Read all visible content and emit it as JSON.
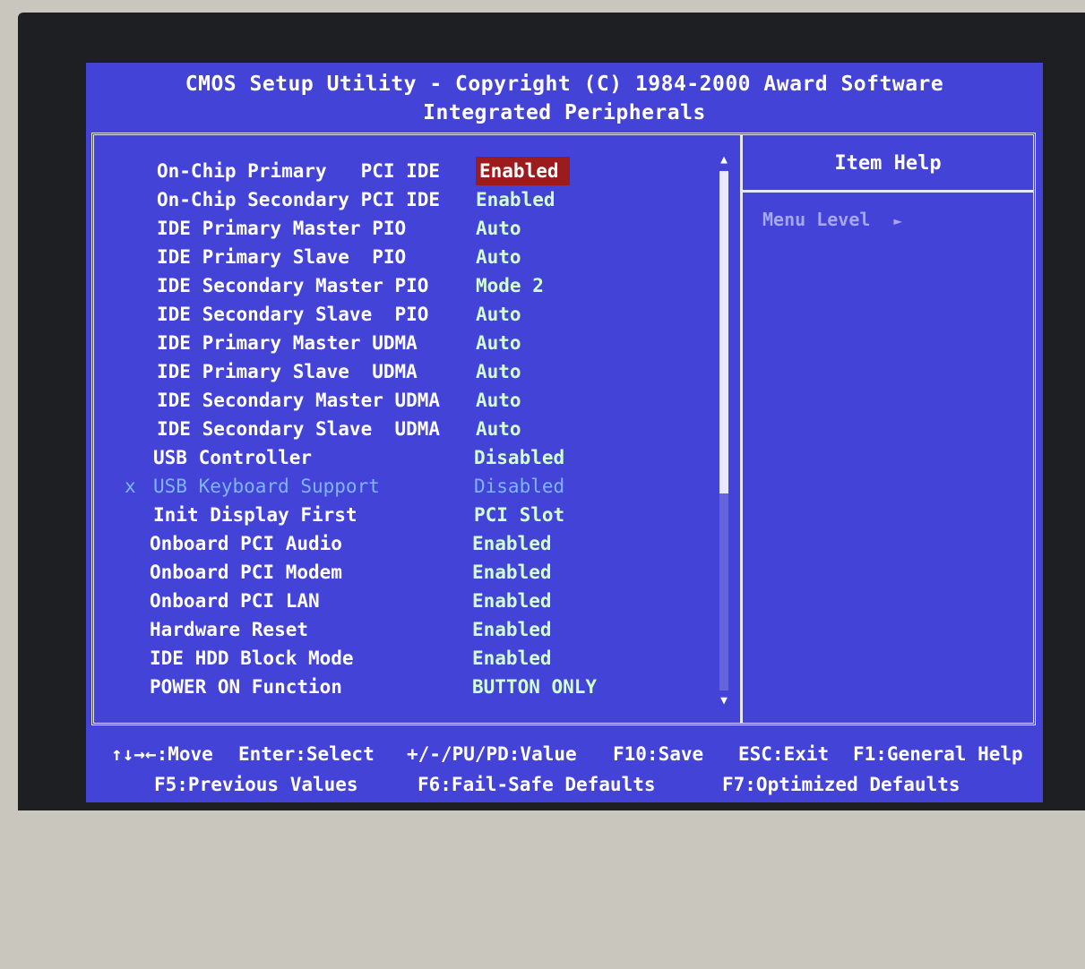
{
  "header": {
    "title": "CMOS Setup Utility - Copyright (C) 1984-2000 Award Software",
    "subtitle": "Integrated Peripherals"
  },
  "settings": [
    {
      "label": "On-Chip Primary   PCI IDE",
      "value": "Enabled",
      "selected": true
    },
    {
      "label": "On-Chip Secondary PCI IDE",
      "value": "Enabled"
    },
    {
      "label": "IDE Primary Master PIO",
      "value": "Auto"
    },
    {
      "label": "IDE Primary Slave  PIO",
      "value": "Auto"
    },
    {
      "label": "IDE Secondary Master PIO",
      "value": "Mode 2"
    },
    {
      "label": "IDE Secondary Slave  PIO",
      "value": "Auto"
    },
    {
      "label": "IDE Primary Master UDMA",
      "value": "Auto"
    },
    {
      "label": "IDE Primary Slave  UDMA",
      "value": "Auto"
    },
    {
      "label": "IDE Secondary Master UDMA",
      "value": "Auto"
    },
    {
      "label": "IDE Secondary Slave  UDMA",
      "value": "Auto"
    },
    {
      "label": "USB Controller",
      "value": "Disabled"
    },
    {
      "label": "USB Keyboard Support",
      "value": "Disabled",
      "disabled": true,
      "prefix": "x"
    },
    {
      "label": "Init Display First",
      "value": "PCI Slot"
    },
    {
      "label": "Onboard PCI Audio",
      "value": "Enabled"
    },
    {
      "label": "Onboard PCI Modem",
      "value": "Enabled"
    },
    {
      "label": "Onboard PCI LAN",
      "value": "Enabled"
    },
    {
      "label": "Hardware Reset",
      "value": "Enabled"
    },
    {
      "label": "IDE HDD Block Mode",
      "value": "Enabled"
    },
    {
      "label": "POWER ON Function",
      "value": "BUTTON ONLY"
    }
  ],
  "scrollbar": {
    "up_arrow": "▲",
    "down_arrow": "▼",
    "visible_fraction": 0.62
  },
  "help_panel": {
    "title": "Item Help",
    "menu_level_label": "Menu Level",
    "menu_level_arrow": "►"
  },
  "footer": {
    "line1": {
      "move": "↑↓→←:Move",
      "select": "Enter:Select",
      "value": "+/-/PU/PD:Value",
      "save": "F10:Save",
      "exit": "ESC:Exit",
      "help": "F1:General Help"
    },
    "line2": {
      "previous": "F5:Previous Values",
      "failsafe": "F6:Fail-Safe Defaults",
      "optimized": "F7:Optimized Defaults"
    }
  },
  "colors": {
    "background": "#4343d8",
    "text": "#ffffff",
    "value": "#d2ffd2",
    "highlight": "#9c1c1e",
    "disabled": "#7fb6ff",
    "menu_level": "#a7a7ee"
  }
}
